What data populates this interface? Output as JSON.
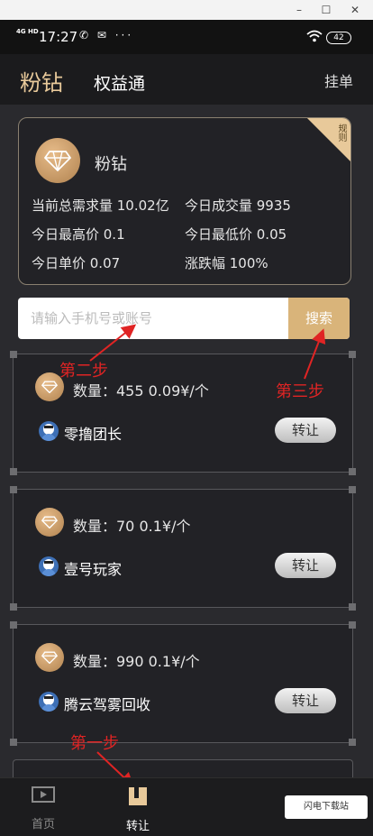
{
  "window": {
    "minimize": "–",
    "maximize": "☐",
    "close": "✕"
  },
  "status_bar": {
    "network": "4G HD",
    "time": "17:27",
    "icons": "✆ ✉ ···",
    "battery": "42"
  },
  "header": {
    "title": "粉钻",
    "subtitle": "权益通",
    "action": "挂单"
  },
  "info_card": {
    "ribbon": "规则",
    "title": "粉钻",
    "stats": [
      "当前总需求量 10.02亿",
      "今日成交量 9935",
      "今日最高价 0.1",
      "今日最低价 0.05",
      "今日单价 0.07",
      "涨跌幅 100%"
    ]
  },
  "search": {
    "placeholder": "请输入手机号或账号",
    "button": "搜索"
  },
  "listings": [
    {
      "qty": "数量：455   0.09¥/个",
      "seller": "零撸团长",
      "action": "转让"
    },
    {
      "qty": "数量：70   0.1¥/个",
      "seller": "壹号玩家",
      "action": "转让"
    },
    {
      "qty": "数量：990   0.1¥/个",
      "seller": "腾云驾雾回收",
      "action": "转让"
    }
  ],
  "annotations": {
    "step1": "第一步",
    "step2": "第二步",
    "step3": "第三步"
  },
  "bottom_nav": [
    {
      "label": "首页",
      "icon": "home-icon"
    },
    {
      "label": "转让",
      "icon": "transfer-icon"
    }
  ],
  "watermark": "闪电下载站",
  "colors": {
    "accent": "#e8c99a",
    "background": "#2a2a2e",
    "annotation": "#e02424"
  }
}
